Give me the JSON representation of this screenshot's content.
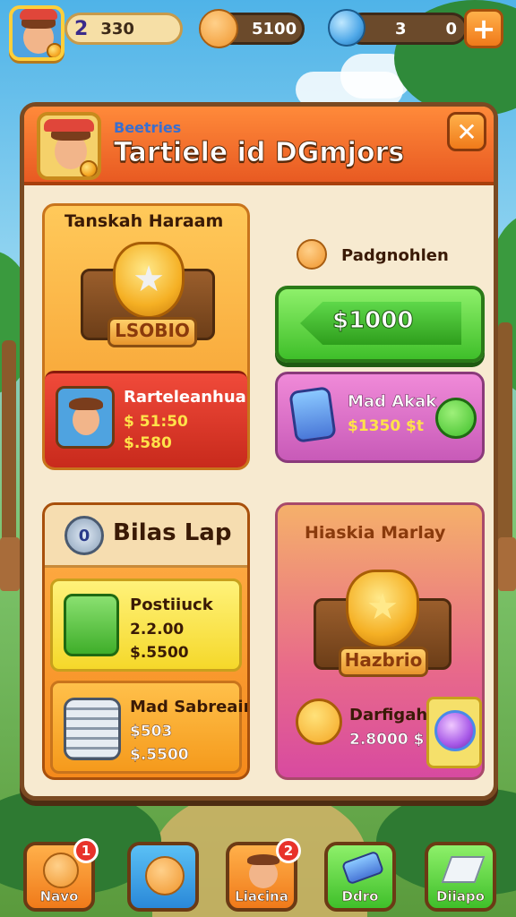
{
  "hud": {
    "level": "2",
    "xp": "330",
    "coins": "5100",
    "gems": "3",
    "gem_extra": "0",
    "plus": "+"
  },
  "panel": {
    "subtitle": "Beetries",
    "title": "Tartiele id DGmjors",
    "close": "✕"
  },
  "card1": {
    "title": "Tanskah Haraam",
    "ribbon": "LSOBIO",
    "item_name": "Rarteleanhuar",
    "price1": "$ 51:50",
    "price2": "$.580"
  },
  "card2": {
    "label": "Padgnohlen",
    "button": "$1000"
  },
  "card3": {
    "name": "Mad Akak",
    "price": "$1350 $t"
  },
  "card4": {
    "badge": "0",
    "title": "Bilas Lap",
    "item1_name": "Postiiuck",
    "item1_price1": "2.2.00",
    "item1_price2": "$.5500",
    "item2_name": "Mad Sabreain",
    "item2_price1": "$503",
    "item2_price2": "$.5500"
  },
  "card5": {
    "title": "Hiaskia Marlay",
    "ribbon": "Hazbrio",
    "item_name": "Darfigah",
    "item_price": "2.8000 $"
  },
  "nav": {
    "items": [
      {
        "label": "Navo",
        "badge": "1"
      },
      {
        "label": "",
        "badge": ""
      },
      {
        "label": "Liacina",
        "badge": "2"
      },
      {
        "label": "Ddro",
        "badge": ""
      },
      {
        "label": "Diiapo",
        "badge": ""
      }
    ]
  },
  "colors": {
    "header": "#e85a22",
    "panel": "#f7ead0",
    "buy": "#3fbf2a"
  }
}
